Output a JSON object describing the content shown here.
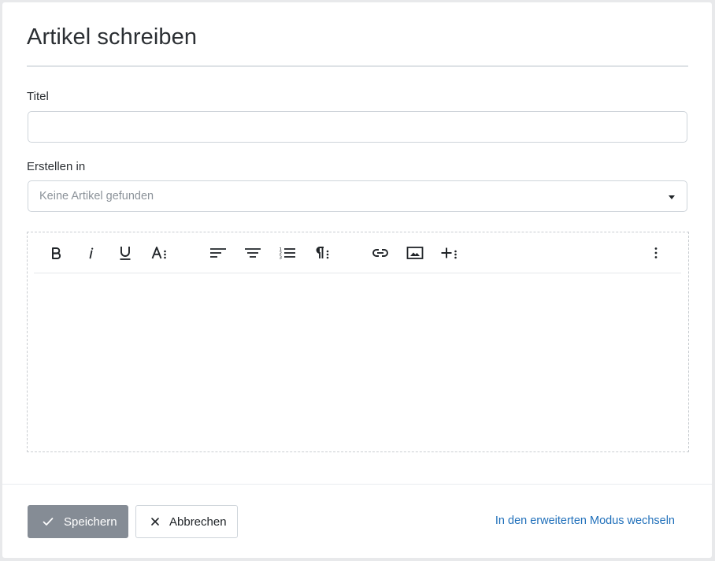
{
  "dialog": {
    "title": "Artikel schreiben"
  },
  "form": {
    "title_label": "Titel",
    "title_value": "",
    "title_placeholder": "",
    "create_in_label": "Erstellen in",
    "create_in_value": "Keine Artikel gefunden"
  },
  "editor": {
    "toolbar": [
      {
        "name": "bold-icon",
        "label": "B"
      },
      {
        "name": "italic-icon",
        "label": "i"
      },
      {
        "name": "underline-icon",
        "label": "U"
      },
      {
        "name": "font-style-menu-icon",
        "label": "A"
      },
      {
        "name": "align-left-icon"
      },
      {
        "name": "align-center-icon"
      },
      {
        "name": "ordered-list-icon"
      },
      {
        "name": "paragraph-menu-icon"
      },
      {
        "name": "link-icon"
      },
      {
        "name": "image-icon"
      },
      {
        "name": "insert-menu-icon"
      },
      {
        "name": "more-options-icon"
      }
    ],
    "content": ""
  },
  "footer": {
    "save_label": "Speichern",
    "cancel_label": "Abbrechen",
    "advanced_mode_link": "In den erweiterten Modus wechseln"
  },
  "colors": {
    "save_button_bg": "#858c95",
    "link_color": "#1f6fba",
    "text": "#212529",
    "border": "#ced4da"
  }
}
